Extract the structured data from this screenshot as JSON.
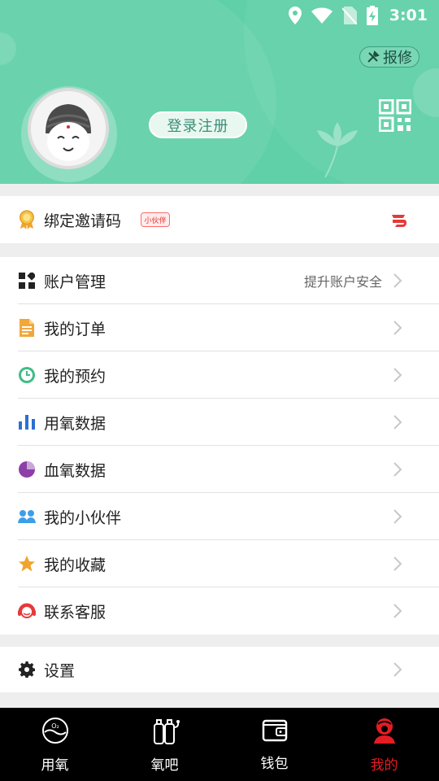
{
  "status_bar": {
    "time": "3:01"
  },
  "header": {
    "repair_label": "报修",
    "login_label": "登录注册"
  },
  "invite": {
    "label": "绑定邀请码",
    "badge": "小伙伴"
  },
  "menu": {
    "items": [
      {
        "label": "账户管理",
        "sub": "提升账户安全",
        "icon": "grid-icon"
      },
      {
        "label": "我的订单",
        "sub": "",
        "icon": "document-icon"
      },
      {
        "label": "我的预约",
        "sub": "",
        "icon": "clock-icon"
      },
      {
        "label": "用氧数据",
        "sub": "",
        "icon": "bar-chart-icon"
      },
      {
        "label": "血氧数据",
        "sub": "",
        "icon": "pie-chart-icon"
      },
      {
        "label": "我的小伙伴",
        "sub": "",
        "icon": "partners-icon"
      },
      {
        "label": "我的收藏",
        "sub": "",
        "icon": "star-icon"
      },
      {
        "label": "联系客服",
        "sub": "",
        "icon": "headset-icon"
      }
    ]
  },
  "settings": {
    "label": "设置"
  },
  "nav": {
    "tabs": [
      {
        "label": "用氧",
        "icon": "oxygen-icon"
      },
      {
        "label": "氧吧",
        "icon": "oxygen-bar-icon"
      },
      {
        "label": "钱包",
        "icon": "wallet-icon"
      },
      {
        "label": "我的",
        "icon": "profile-icon"
      }
    ],
    "active_color": "#e51c23"
  },
  "colors": {
    "header_bg": "#5fd0a8",
    "accent": "#e51c23"
  }
}
